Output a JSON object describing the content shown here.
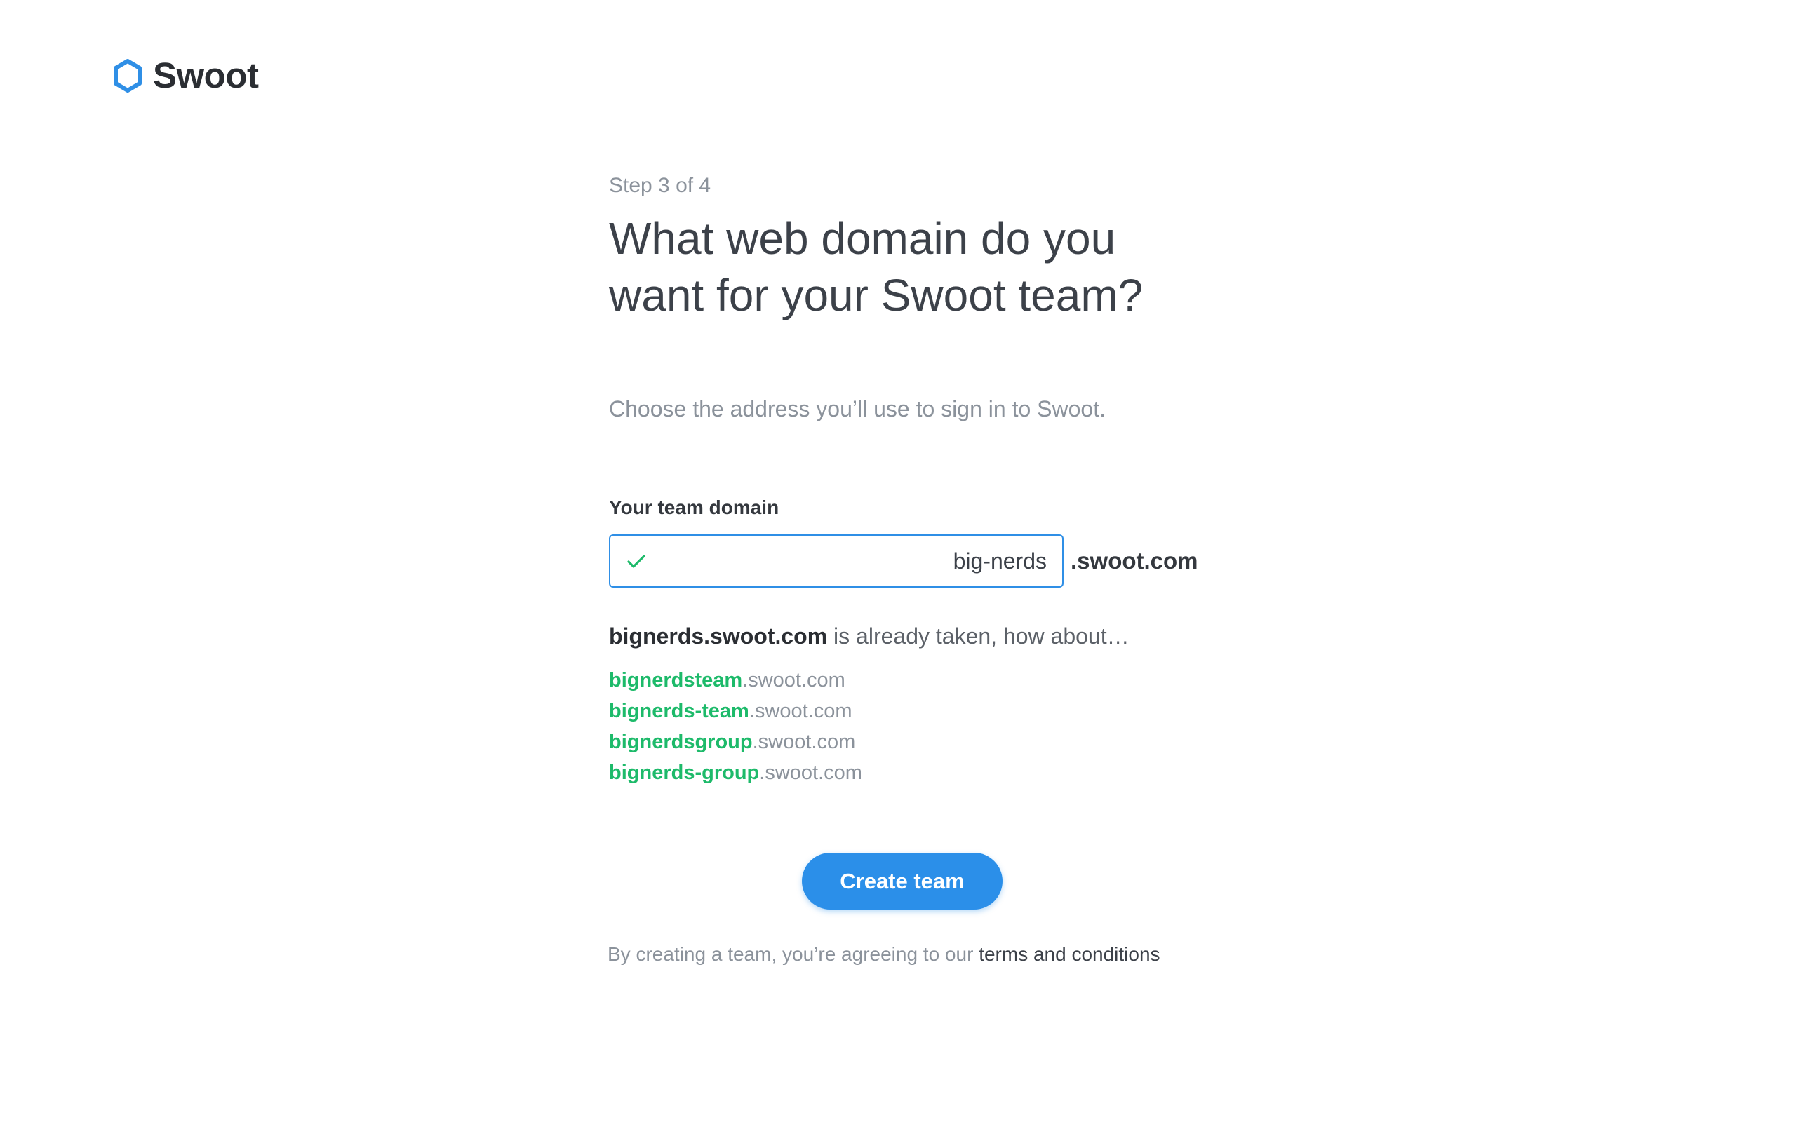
{
  "brand": {
    "name": "Swoot",
    "logo_color": "#2f8fe6"
  },
  "step": "Step 3 of 4",
  "title_line1": "What web domain do you",
  "title_line2": "want for your Swoot team?",
  "subtitle": "Choose the address you’ll use to sign in to Swoot.",
  "domain_field": {
    "label": "Your team domain",
    "value": "big-nerds",
    "suffix": ".swoot.com",
    "status_icon": "check-icon",
    "status_color": "#1dba6a"
  },
  "taken_message": {
    "domain": "bignerds.swoot.com",
    "text": " is already taken, how about…"
  },
  "suggestions": [
    {
      "name": "bignerdsteam",
      "suffix": ".swoot.com"
    },
    {
      "name": "bignerds-team",
      "suffix": ".swoot.com"
    },
    {
      "name": "bignerdsgroup",
      "suffix": ".swoot.com"
    },
    {
      "name": "bignerds-group",
      "suffix": ".swoot.com"
    }
  ],
  "create_button": {
    "label": "Create team",
    "color": "#2b8fe9"
  },
  "terms": {
    "prefix": "By creating a team, you’re agreeing to our ",
    "link_text": "terms and conditions"
  }
}
